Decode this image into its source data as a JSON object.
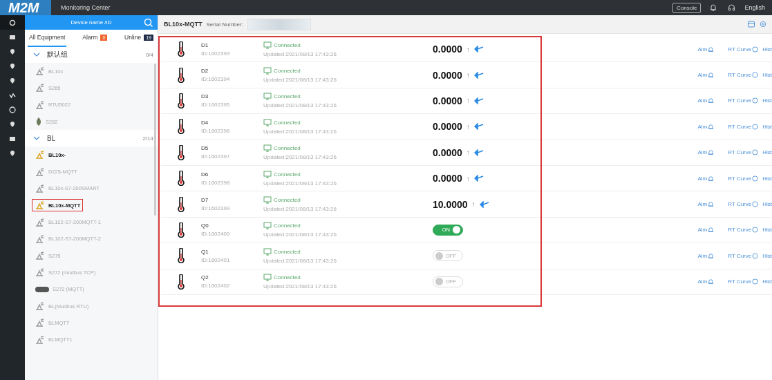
{
  "top_bar": {
    "logo": "M2M",
    "title": "Monitoring Center",
    "console_button": "Console",
    "language": "English"
  },
  "rail": {
    "items": [
      {
        "selected": true
      },
      {
        "selected": false
      },
      {
        "selected": false
      },
      {
        "selected": false
      },
      {
        "selected": false
      },
      {
        "selected": false
      },
      {
        "selected": false
      },
      {
        "selected": false
      },
      {
        "selected": false
      },
      {
        "selected": false
      }
    ]
  },
  "device_panel": {
    "search": {
      "placeholder": "Device name /ID"
    },
    "tabs": [
      {
        "label": "All Equipment",
        "selected": true
      },
      {
        "label": "Alarm",
        "badge": "0",
        "color": "#f0642d",
        "selected": false
      },
      {
        "label": "Unline",
        "badge": "19",
        "color": "#1f2d4a",
        "selected": false
      }
    ],
    "groups": [
      {
        "name": "默认组",
        "count": "0/4",
        "expanded": true,
        "children": [
          {
            "name": "BL10x",
            "kind": "antenna",
            "online": false,
            "selected": false
          },
          {
            "name": "S265",
            "kind": "antenna",
            "online": false,
            "selected": false
          },
          {
            "name": "RTU5022",
            "kind": "antenna",
            "online": false,
            "selected": false
          },
          {
            "name": "S282",
            "kind": "plant",
            "online": false,
            "selected": false
          }
        ]
      },
      {
        "name": "BL",
        "count": "2/14",
        "expanded": true,
        "children": [
          {
            "name": "BL10x-",
            "kind": "antenna",
            "online": true,
            "selected": false
          },
          {
            "name": "D225-MQTT",
            "kind": "antenna",
            "online": false,
            "selected": false
          },
          {
            "name": "BL10x-S7-200SMART",
            "kind": "antenna",
            "online": false,
            "selected": false
          },
          {
            "name": "BL10x-MQTT",
            "kind": "antenna",
            "online": true,
            "selected": true
          },
          {
            "name": "BL102-S7-200MQTT-1",
            "kind": "antenna",
            "online": false,
            "selected": false
          },
          {
            "name": "BL102-S7-200MQTT-2",
            "kind": "antenna",
            "online": false,
            "selected": false
          },
          {
            "name": "S275",
            "kind": "antenna",
            "online": false,
            "selected": false
          },
          {
            "name": "S272 (modbus TCP)",
            "kind": "antenna",
            "online": false,
            "selected": false
          },
          {
            "name": "S272  (MQTT)",
            "kind": "router",
            "online": false,
            "selected": false
          },
          {
            "name": "BL(Modbus RTU)",
            "kind": "antenna",
            "online": false,
            "selected": false
          },
          {
            "name": "BLMQTT",
            "kind": "antenna",
            "online": false,
            "selected": false
          },
          {
            "name": "BLMQTT1",
            "kind": "antenna",
            "online": false,
            "selected": false
          }
        ]
      }
    ]
  },
  "device_header": {
    "title": "BL10x-MQTT",
    "serial_label": "Serial Number:"
  },
  "points": [
    {
      "name": "D1",
      "id": "ID:1602393",
      "status": "Connected",
      "updated": "Updated:2021/08/13 17:43:26",
      "kind": "value",
      "value": "0.0000",
      "up_arrow": "↑",
      "alarm": "Alm",
      "curve": "RT Curve",
      "history": "Hist"
    },
    {
      "name": "D2",
      "id": "ID:1602394",
      "status": "Connected",
      "updated": "Updated:2021/08/13 17:43:26",
      "kind": "value",
      "value": "0.0000",
      "up_arrow": "↑",
      "alarm": "Alm",
      "curve": "RT Curve",
      "history": "Hist"
    },
    {
      "name": "D3",
      "id": "ID:1602395",
      "status": "Connected",
      "updated": "Updated:2021/08/13 17:43:26",
      "kind": "value",
      "value": "0.0000",
      "up_arrow": "↑",
      "alarm": "Alm",
      "curve": "RT Curve",
      "history": "Hist"
    },
    {
      "name": "D4",
      "id": "ID:1602396",
      "status": "Connected",
      "updated": "Updated:2021/08/13 17:43:26",
      "kind": "value",
      "value": "0.0000",
      "up_arrow": "↑",
      "alarm": "Alm",
      "curve": "RT Curve",
      "history": "Hist"
    },
    {
      "name": "D5",
      "id": "ID:1602397",
      "status": "Connected",
      "updated": "Updated:2021/08/13 17:43:26",
      "kind": "value",
      "value": "0.0000",
      "up_arrow": "↑",
      "alarm": "Alm",
      "curve": "RT Curve",
      "history": "Hist"
    },
    {
      "name": "D6",
      "id": "ID:1602398",
      "status": "Connected",
      "updated": "Updated:2021/08/13 17:43:26",
      "kind": "value",
      "value": "0.0000",
      "up_arrow": "↑",
      "alarm": "Alm",
      "curve": "RT Curve",
      "history": "Hist"
    },
    {
      "name": "D7",
      "id": "ID:1602399",
      "status": "Connected",
      "updated": "Updated:2021/08/13 17:43:26",
      "kind": "value",
      "value": "10.0000",
      "up_arrow": "↑",
      "alarm": "Alm",
      "curve": "RT Curve",
      "history": "Hist"
    },
    {
      "name": "Q0",
      "id": "ID:1602400",
      "status": "Connected",
      "updated": "Updated:2021/08/13 17:43:26",
      "kind": "switch",
      "on": true,
      "switch_label": "ON",
      "alarm": "Alm",
      "curve": "RT Curve",
      "history": "Hist"
    },
    {
      "name": "Q1",
      "id": "ID:1602401",
      "status": "Connected",
      "updated": "Updated:2021/08/13 17:43:26",
      "kind": "switch",
      "on": false,
      "switch_label": "OFF",
      "alarm": "Alm",
      "curve": "RT Curve",
      "history": "Hist"
    },
    {
      "name": "Q2",
      "id": "ID:1602402",
      "status": "Connected",
      "updated": "Updated:2021/08/13 17:43:26",
      "kind": "switch",
      "on": false,
      "switch_label": "OFF",
      "alarm": "Alm",
      "curve": "RT Curve",
      "history": "Hist"
    }
  ]
}
